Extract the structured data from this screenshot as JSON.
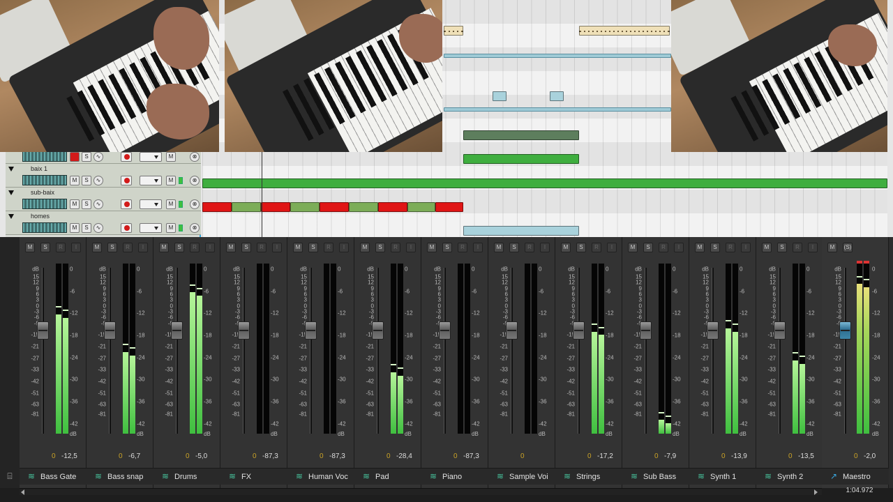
{
  "tracks": [
    {
      "name": ""
    },
    {
      "name": "baix 1"
    },
    {
      "name": "sub-baix"
    },
    {
      "name": "homes"
    }
  ],
  "track_buttons": {
    "mute": "M",
    "solo": "S",
    "monitor": "M"
  },
  "scale_left": [
    "dB",
    "15",
    "12",
    "9",
    "6",
    "3",
    "0",
    "-3",
    "-6",
    "-9",
    "-15",
    "-21",
    "-27",
    "-33",
    "-42",
    "-51",
    "-63",
    "-81"
  ],
  "scale_right": [
    "0",
    "-6",
    "-12",
    "-18",
    "-24",
    "-30",
    "-36",
    "-42"
  ],
  "scale_right_unit": "dB",
  "channel_buttons": {
    "mute": "M",
    "solo": "S",
    "read": "R",
    "input": "I"
  },
  "master_buttons": {
    "mute": "M",
    "solo": "(S)"
  },
  "channels": [
    {
      "name": "Bass Gate",
      "pan": "0",
      "volume": "-12,5",
      "fader": 0.62,
      "meter": 0.7
    },
    {
      "name": "Bass snap",
      "pan": "0",
      "volume": "-6,7",
      "fader": 0.62,
      "meter": 0.48
    },
    {
      "name": "Drums",
      "pan": "0",
      "volume": "-5,0",
      "fader": 0.62,
      "meter": 0.83
    },
    {
      "name": "FX",
      "pan": "0",
      "volume": "-87,3",
      "fader": 0.62,
      "meter": 0.0
    },
    {
      "name": "Human Voc",
      "pan": "0",
      "volume": "-87,3",
      "fader": 0.62,
      "meter": 0.0
    },
    {
      "name": "Pad",
      "pan": "0",
      "volume": "-28,4",
      "fader": 0.62,
      "meter": 0.36
    },
    {
      "name": "Piano",
      "pan": "0",
      "volume": "-87,3",
      "fader": 0.62,
      "meter": 0.0
    },
    {
      "name": "Sample Voi",
      "pan": "0",
      "volume": "",
      "fader": 0.62,
      "meter": 0.0
    },
    {
      "name": "Strings",
      "pan": "0",
      "volume": "-17,2",
      "fader": 0.62,
      "meter": 0.6
    },
    {
      "name": "Sub Bass",
      "pan": "0",
      "volume": "-7,9",
      "fader": 0.62,
      "meter": 0.08
    },
    {
      "name": "Synth 1",
      "pan": "0",
      "volume": "-13,9",
      "fader": 0.62,
      "meter": 0.62
    },
    {
      "name": "Synth 2",
      "pan": "0",
      "volume": "-13,5",
      "fader": 0.62,
      "meter": 0.43
    }
  ],
  "master": {
    "name": "Maestro",
    "pan": "0",
    "volume": "-2,0",
    "fader": 0.62,
    "meter": 0.88
  },
  "time_display": "1:04.972",
  "colors": {
    "accent": "#2ea7e0",
    "clip_green": "#3fae3f",
    "clip_red": "#e01515",
    "meter_green": "#3fbf3f",
    "pan_yellow": "#c9a227"
  }
}
